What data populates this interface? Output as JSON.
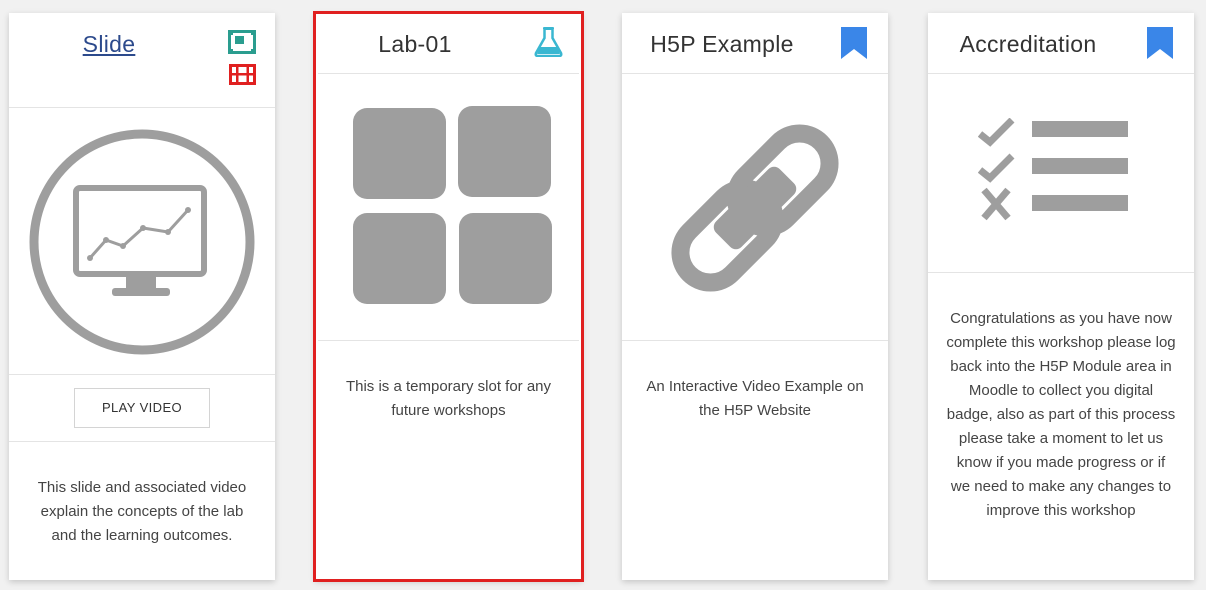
{
  "cards": [
    {
      "title": "Slide",
      "button_label": "PLAY VIDEO",
      "description": "This slide and associated video explain the concepts of the lab and the learning outcomes.",
      "icons": [
        "slide-icon",
        "film-icon"
      ],
      "image": "monitor-chart-icon"
    },
    {
      "title": "Lab-01",
      "description": "This is a temporary slot for any future workshops",
      "icons": [
        "flask-icon"
      ],
      "image": "grid-tiles-icon"
    },
    {
      "title": "H5P Example",
      "description": "An Interactive Video Example on the H5P Website",
      "icons": [
        "bookmark-icon"
      ],
      "image": "chain-link-icon"
    },
    {
      "title": "Accreditation",
      "description": "Congratulations as you have now complete this workshop please log back into the H5P Module area in Moodle to collect you digital badge, also as part of this process please take a moment to let us know if you made progress or if we need to make any changes to improve this workshop",
      "icons": [
        "bookmark-icon"
      ],
      "image": "checklist-icon"
    }
  ],
  "colors": {
    "slide_icon": "#2a9d8f",
    "film_icon": "#e02020",
    "flask_icon": "#3ab7d1",
    "bookmark_icon": "#3a86e8",
    "image_gray": "#9e9e9e",
    "highlight_border": "#e02020"
  }
}
